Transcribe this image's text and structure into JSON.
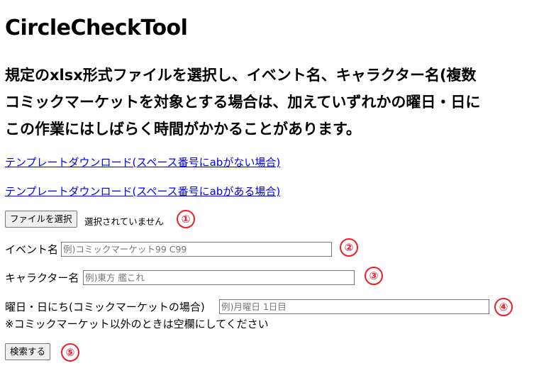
{
  "title": "CircleCheckTool",
  "description": [
    "規定のxlsx形式ファイルを選択し、イベント名、キャラクター名(複数",
    "コミックマーケットを対象とする場合は、加えていずれかの曜日・日に",
    "この作業にはしばらく時間がかかることがあります。"
  ],
  "links": {
    "template_no_ab": "テンプレートダウンロード(スペース番号にabがない場合)",
    "template_ab": "テンプレートダウンロード(スペース番号にabがある場合)"
  },
  "file": {
    "button_label": "ファイルを選択",
    "status": "選択されていません"
  },
  "fields": {
    "event_label": "イベント名",
    "event_placeholder": "例)コミックマーケット99 C99",
    "character_label": "キャラクター名",
    "character_placeholder": "例)東方 艦これ",
    "day_label": "曜日・日にち(コミックマーケットの場合)",
    "day_placeholder": "例)月曜日 1日目",
    "day_note": "※コミックマーケット以外のときは空欄にしてください"
  },
  "search_button": "検索する",
  "markers": [
    "①",
    "②",
    "③",
    "④",
    "⑤"
  ],
  "colors": {
    "link": "#0000ee",
    "marker": "#e8202a"
  }
}
